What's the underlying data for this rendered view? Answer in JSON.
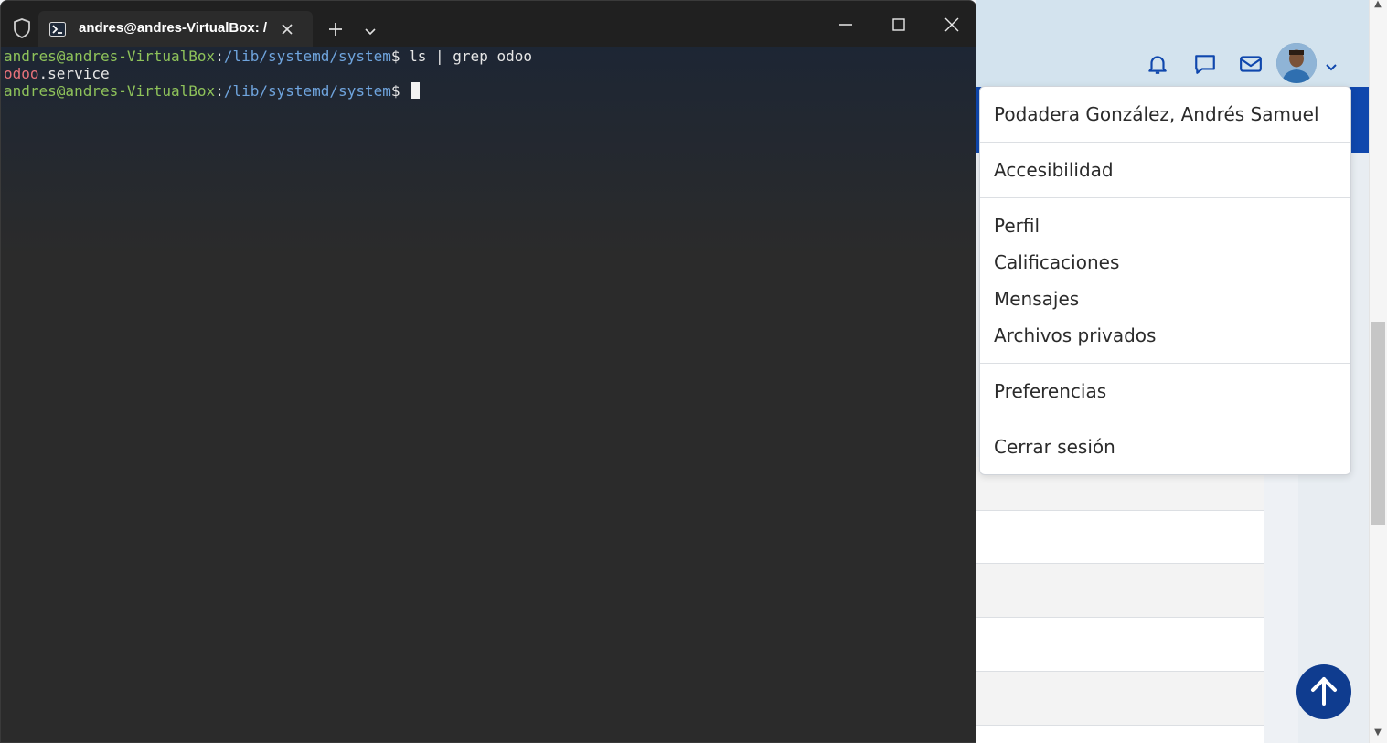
{
  "terminal": {
    "tab_title": "andres@andres-VirtualBox: /l",
    "lines": [
      {
        "user": "andres@andres-VirtualBox",
        "sep": ":",
        "path": "/lib/systemd/system",
        "prompt": "$ ",
        "command": "ls | grep odoo"
      },
      {
        "match": "odoo",
        "rest": ".service"
      },
      {
        "user": "andres@andres-VirtualBox",
        "sep": ":",
        "path": "/lib/systemd/system",
        "prompt": "$ ",
        "command": ""
      }
    ]
  },
  "user_menu": {
    "full_name": "Podadera González, Andrés Samuel",
    "accessibility": "Accesibilidad",
    "profile": "Perfil",
    "grades": "Calificaciones",
    "messages": "Mensajes",
    "private_files": "Archivos privados",
    "preferences": "Preferencias",
    "logout": "Cerrar sesión"
  },
  "icons": {
    "shield": "shield-icon",
    "terminal_tab": "powershell-icon",
    "tab_close": "close-icon",
    "new_tab": "plus-icon",
    "tab_dropdown": "chevron-down-icon",
    "minimize": "minimize-icon",
    "maximize": "maximize-icon",
    "close": "close-icon",
    "notifications": "bell-icon",
    "chat": "chat-bubble-icon",
    "mail": "envelope-icon",
    "avatar_menu": "chevron-down-icon",
    "scroll_top": "arrow-up-icon"
  },
  "colors": {
    "terminal_bg": "#2b2b2b",
    "prompt_user": "#8ec25a",
    "prompt_path": "#6fa4dd",
    "grep_match": "#e8727a",
    "brand_blue": "#0f47ad"
  }
}
